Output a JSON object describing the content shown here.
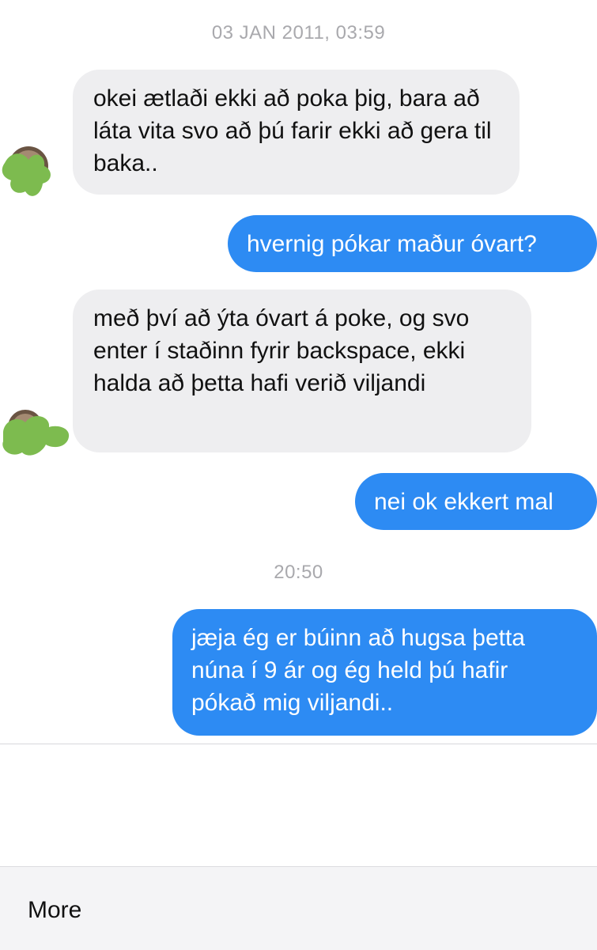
{
  "conversation": {
    "timestamp_first": "03 JAN 2011, 03:59",
    "timestamp_second": "20:50",
    "messages": [
      {
        "direction": "incoming",
        "text": "okei ætlaði ekki að poka þig, bara að láta vita svo að þú farir ekki að gera til baka.."
      },
      {
        "direction": "outgoing",
        "text": "hvernig pókar maður óvart?"
      },
      {
        "direction": "incoming",
        "text": "með því að ýta óvart á poke, og svo enter í staðinn fyrir backspace, ekki halda að þetta hafi verið viljandi"
      },
      {
        "direction": "outgoing",
        "text": "nei ok ekkert mal"
      },
      {
        "direction": "outgoing",
        "text": "jæja ég er búinn að hugsa þetta núna í 9 ár og ég held þú hafir pókað mig viljandi.."
      }
    ]
  },
  "colors": {
    "outgoing_bubble": "#2d8bf3",
    "incoming_bubble": "#eeeef0",
    "redaction_scribble": "#7dbb4f"
  },
  "icons": {
    "avatar": "avatar-icon (redacted with green scribble)"
  },
  "bottom_bar": {
    "more_label": "More"
  }
}
